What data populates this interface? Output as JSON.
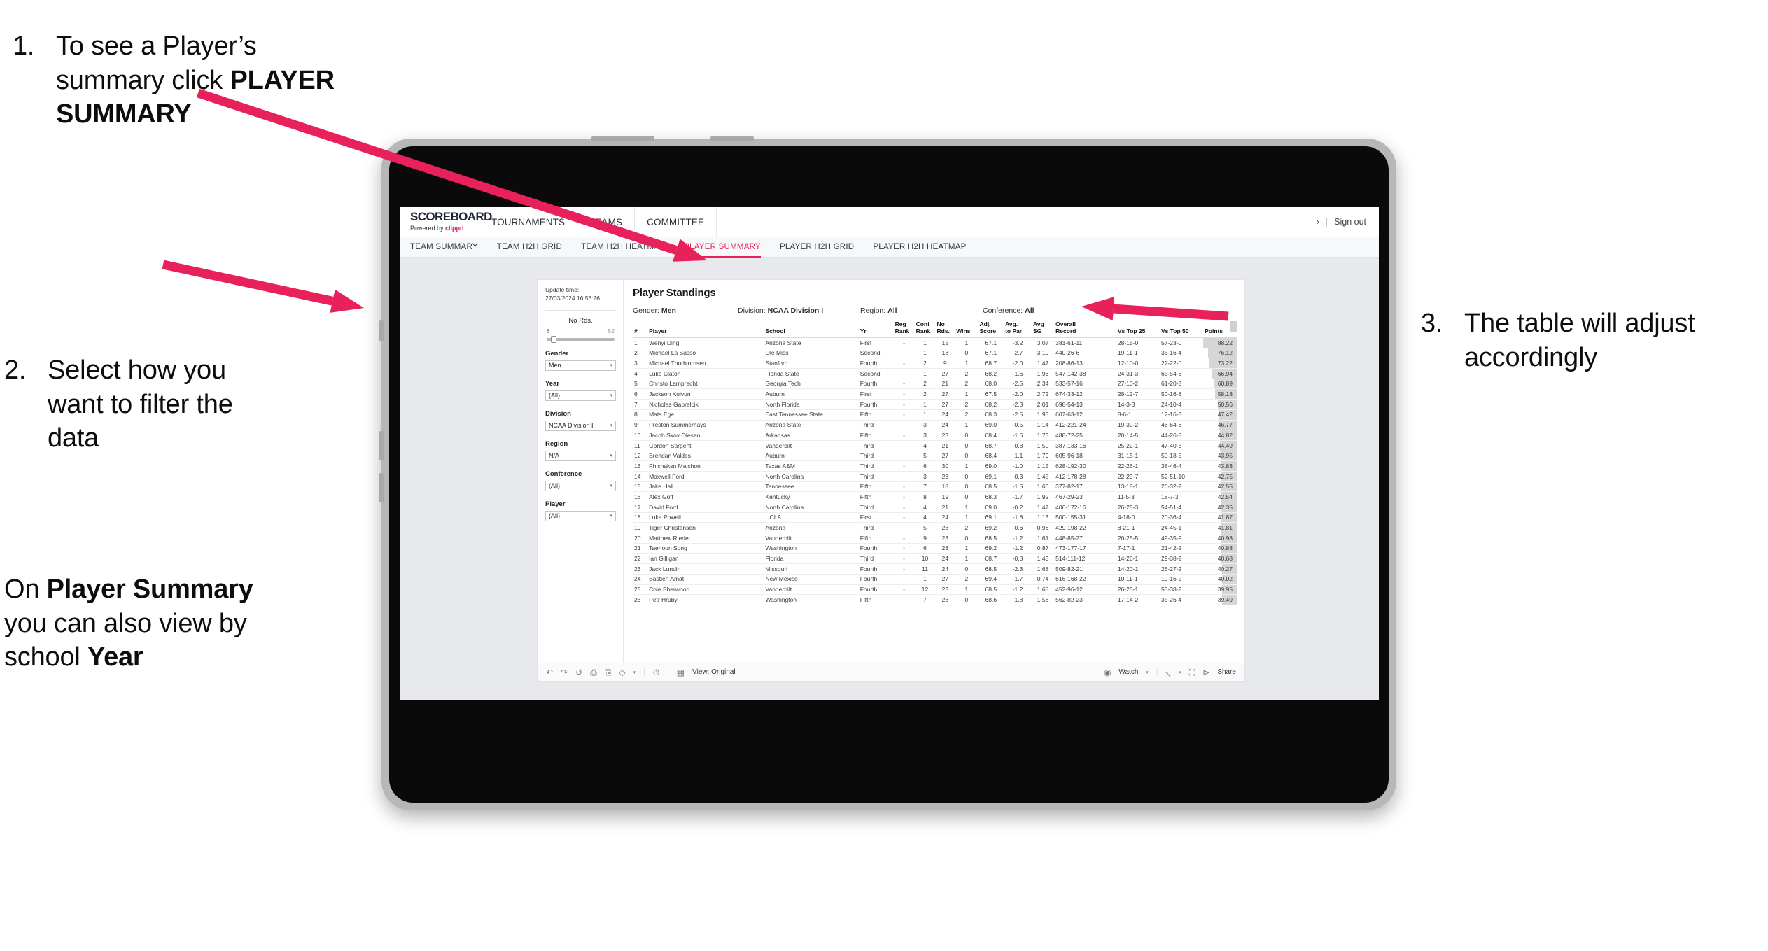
{
  "annotations": [
    {
      "id": "anno1",
      "number": "1.",
      "parts": [
        {
          "t": "To see a Player’s summary click ",
          "b": false
        },
        {
          "t": "PLAYER SUMMARY",
          "b": true
        }
      ]
    },
    {
      "id": "anno2",
      "number": "2.",
      "parts": [
        {
          "t": "Select how you want to filter the data",
          "b": false
        }
      ]
    },
    {
      "id": "anno2b",
      "number": "",
      "parts": [
        {
          "t": "On ",
          "b": false
        },
        {
          "t": "Player Summary",
          "b": true
        },
        {
          "t": " you can also view by school ",
          "b": false
        },
        {
          "t": "Year",
          "b": true
        }
      ]
    },
    {
      "id": "anno3",
      "number": "3.",
      "parts": [
        {
          "t": "The table will adjust accordingly",
          "b": false
        }
      ]
    }
  ],
  "accent_color": "#e8215a",
  "app": {
    "brand": {
      "title": "SCOREBOARD",
      "powered_prefix": "Powered by ",
      "powered_name": "clippd"
    },
    "topnav": [
      "TOURNAMENTS",
      "TEAMS",
      "COMMITTEE"
    ],
    "topright": {
      "chevron": "›",
      "divider": "|",
      "signout": "Sign out"
    },
    "subnav": [
      {
        "label": "TEAM SUMMARY",
        "active": false
      },
      {
        "label": "TEAM H2H GRID",
        "active": false
      },
      {
        "label": "TEAM H2H HEATMAP",
        "active": false
      },
      {
        "label": "PLAYER SUMMARY",
        "active": true
      },
      {
        "label": "PLAYER H2H GRID",
        "active": false
      },
      {
        "label": "PLAYER H2H HEATMAP",
        "active": false
      }
    ]
  },
  "workbook": {
    "update_label": "Update time:",
    "update_time": "27/03/2024 16:56:26",
    "title": "Player Standings",
    "filters": {
      "slider": {
        "title": "No Rds.",
        "min": "6",
        "max": "52"
      },
      "selects": [
        {
          "title": "Gender",
          "value": "Men"
        },
        {
          "title": "Year",
          "value": "(All)"
        },
        {
          "title": "Division",
          "value": "NCAA Division I"
        },
        {
          "title": "Region",
          "value": "N/A"
        },
        {
          "title": "Conference",
          "value": "(All)"
        },
        {
          "title": "Player",
          "value": "(All)"
        }
      ]
    },
    "crumbs": [
      {
        "key": "Gender: ",
        "value": "Men"
      },
      {
        "key": "Division: ",
        "value": "NCAA Division I"
      },
      {
        "key": "Region: ",
        "value": "All"
      },
      {
        "key": "Conference: ",
        "value": "All"
      }
    ],
    "toolbar": {
      "undo": "↶",
      "redo": "↷",
      "revert": "↺",
      "view_label": "View: Original",
      "watch_label": "Watch",
      "share_label": "Share",
      "caret": "▾",
      "divider": "|"
    }
  },
  "chart_data": {
    "type": "table",
    "title": "Player Standings",
    "columns": [
      "#",
      "Player",
      "School",
      "Yr",
      "Reg Rank",
      "Conf Rank",
      "No Rds.",
      "Wins",
      "Adj. Score",
      "Avg. to Par",
      "Avg SG",
      "Overall Record",
      "Vs Top 25",
      "Vs Top 50",
      "Points"
    ],
    "header_lines": [
      [
        "#"
      ],
      [
        "Player"
      ],
      [
        "School"
      ],
      [
        "Yr"
      ],
      [
        "Reg",
        "Rank"
      ],
      [
        "Conf",
        "Rank"
      ],
      [
        "No",
        "Rds."
      ],
      [
        "Wins"
      ],
      [
        "Adj.",
        "Score"
      ],
      [
        "Avg.",
        "to Par"
      ],
      [
        "Avg",
        "SG"
      ],
      [
        "Overall",
        "Record"
      ],
      [
        "Vs Top 25"
      ],
      [
        "Vs Top 50"
      ],
      [
        "Points"
      ]
    ],
    "points_max": 88.22,
    "rows": [
      [
        "1",
        "Wenyi Ding",
        "Arizona State",
        "First",
        "-",
        "1",
        "15",
        "1",
        "67.1",
        "-3.2",
        "3.07",
        "381-61-11",
        "28-15-0",
        "57-23-0",
        "88.22"
      ],
      [
        "2",
        "Michael La Sasso",
        "Ole Miss",
        "Second",
        "-",
        "1",
        "18",
        "0",
        "67.1",
        "-2.7",
        "3.10",
        "440-26-6",
        "19-11-1",
        "35-16-4",
        "76.12"
      ],
      [
        "3",
        "Michael Thorbjornsen",
        "Stanford",
        "Fourth",
        "-",
        "2",
        "9",
        "1",
        "68.7",
        "-2.0",
        "1.47",
        "208-86-13",
        "12-10-0",
        "22-22-0",
        "73.22"
      ],
      [
        "4",
        "Luke Claton",
        "Florida State",
        "Second",
        "-",
        "1",
        "27",
        "2",
        "68.2",
        "-1.6",
        "1.98",
        "547-142-38",
        "24-31-3",
        "65-54-6",
        "66.94"
      ],
      [
        "5",
        "Christo Lamprecht",
        "Georgia Tech",
        "Fourth",
        "-",
        "2",
        "21",
        "2",
        "68.0",
        "-2.5",
        "2.34",
        "533-57-16",
        "27-10-2",
        "61-20-3",
        "60.89"
      ],
      [
        "6",
        "Jackson Koivun",
        "Auburn",
        "First",
        "-",
        "2",
        "27",
        "1",
        "67.5",
        "-2.0",
        "2.72",
        "674-33-12",
        "28-12-7",
        "50-16-8",
        "58.18"
      ],
      [
        "7",
        "Nicholas Gabrelcik",
        "North Florida",
        "Fourth",
        "-",
        "1",
        "27",
        "2",
        "68.2",
        "-2.3",
        "2.01",
        "698-54-13",
        "14-3-3",
        "24-10-4",
        "50.56"
      ],
      [
        "8",
        "Mats Ege",
        "East Tennessee State",
        "Fifth",
        "-",
        "1",
        "24",
        "2",
        "68.3",
        "-2.5",
        "1.93",
        "607-63-12",
        "8-6-1",
        "12-16-3",
        "47.42"
      ],
      [
        "9",
        "Preston Summerhays",
        "Arizona State",
        "Third",
        "-",
        "3",
        "24",
        "1",
        "69.0",
        "-0.5",
        "1.14",
        "412-221-24",
        "19-39-2",
        "46-64-6",
        "46.77"
      ],
      [
        "10",
        "Jacob Skov Olesen",
        "Arkansas",
        "Fifth",
        "-",
        "3",
        "23",
        "0",
        "68.4",
        "-1.5",
        "1.73",
        "488-72-25",
        "20-14-5",
        "44-26-8",
        "44.82"
      ],
      [
        "11",
        "Gordon Sargent",
        "Vanderbilt",
        "Third",
        "-",
        "4",
        "21",
        "0",
        "68.7",
        "-0.8",
        "1.50",
        "387-133-16",
        "25-22-1",
        "47-40-3",
        "44.49"
      ],
      [
        "12",
        "Brendan Valdes",
        "Auburn",
        "Third",
        "-",
        "5",
        "27",
        "0",
        "68.4",
        "-1.1",
        "1.79",
        "605-96-18",
        "31-15-1",
        "50-18-5",
        "43.95"
      ],
      [
        "13",
        "Phichaksn Maichon",
        "Texas A&M",
        "Third",
        "-",
        "6",
        "30",
        "1",
        "69.0",
        "-1.0",
        "1.15",
        "628-192-30",
        "22-26-1",
        "38-46-4",
        "43.83"
      ],
      [
        "14",
        "Maxwell Ford",
        "North Carolina",
        "Third",
        "-",
        "3",
        "23",
        "0",
        "69.1",
        "-0.3",
        "1.45",
        "412-178-28",
        "22-29-7",
        "52-51-10",
        "42.75"
      ],
      [
        "15",
        "Jake Hall",
        "Tennessee",
        "Fifth",
        "-",
        "7",
        "18",
        "0",
        "68.5",
        "-1.5",
        "1.66",
        "377-82-17",
        "13-18-1",
        "26-32-2",
        "42.55"
      ],
      [
        "16",
        "Alex Goff",
        "Kentucky",
        "Fifth",
        "-",
        "8",
        "19",
        "0",
        "68.3",
        "-1.7",
        "1.92",
        "467-29-23",
        "11-5-3",
        "18-7-3",
        "42.54"
      ],
      [
        "17",
        "David Ford",
        "North Carolina",
        "Third",
        "-",
        "4",
        "21",
        "1",
        "69.0",
        "-0.2",
        "1.47",
        "406-172-16",
        "26-25-3",
        "54-51-4",
        "42.35"
      ],
      [
        "18",
        "Luke Powell",
        "UCLA",
        "First",
        "-",
        "4",
        "24",
        "1",
        "69.1",
        "-1.8",
        "1.13",
        "500-155-31",
        "4-18-0",
        "20-36-4",
        "41.87"
      ],
      [
        "19",
        "Tiger Christensen",
        "Arizona",
        "Third",
        "-",
        "5",
        "23",
        "2",
        "69.2",
        "-0.6",
        "0.96",
        "429-198-22",
        "8-21-1",
        "24-45-1",
        "41.81"
      ],
      [
        "20",
        "Matthew Riedel",
        "Vanderbilt",
        "Fifth",
        "-",
        "9",
        "23",
        "0",
        "68.5",
        "-1.2",
        "1.61",
        "448-85-27",
        "20-25-5",
        "49-35-9",
        "40.98"
      ],
      [
        "21",
        "Taehoon Song",
        "Washington",
        "Fourth",
        "-",
        "6",
        "23",
        "1",
        "69.2",
        "-1.2",
        "0.87",
        "473-177-17",
        "7-17-1",
        "21-42-2",
        "40.88"
      ],
      [
        "22",
        "Ian Gilligan",
        "Florida",
        "Third",
        "-",
        "10",
        "24",
        "1",
        "68.7",
        "-0.8",
        "1.43",
        "514-111-12",
        "14-26-1",
        "29-38-2",
        "40.68"
      ],
      [
        "23",
        "Jack Lundin",
        "Missouri",
        "Fourth",
        "-",
        "11",
        "24",
        "0",
        "68.5",
        "-2.3",
        "1.68",
        "509-82-21",
        "14-20-1",
        "26-27-2",
        "40.27"
      ],
      [
        "24",
        "Bastien Amat",
        "New Mexico",
        "Fourth",
        "-",
        "1",
        "27",
        "2",
        "69.4",
        "-1.7",
        "0.74",
        "616-168-22",
        "10-11-1",
        "19-16-2",
        "40.02"
      ],
      [
        "25",
        "Cole Sherwood",
        "Vanderbilt",
        "Fourth",
        "-",
        "12",
        "23",
        "1",
        "68.5",
        "-1.2",
        "1.65",
        "452-96-12",
        "26-23-1",
        "53-38-2",
        "39.95"
      ],
      [
        "26",
        "Petr Hruby",
        "Washington",
        "Fifth",
        "-",
        "7",
        "23",
        "0",
        "68.6",
        "-1.8",
        "1.56",
        "562-82-23",
        "17-14-2",
        "35-26-4",
        "39.49"
      ]
    ]
  }
}
